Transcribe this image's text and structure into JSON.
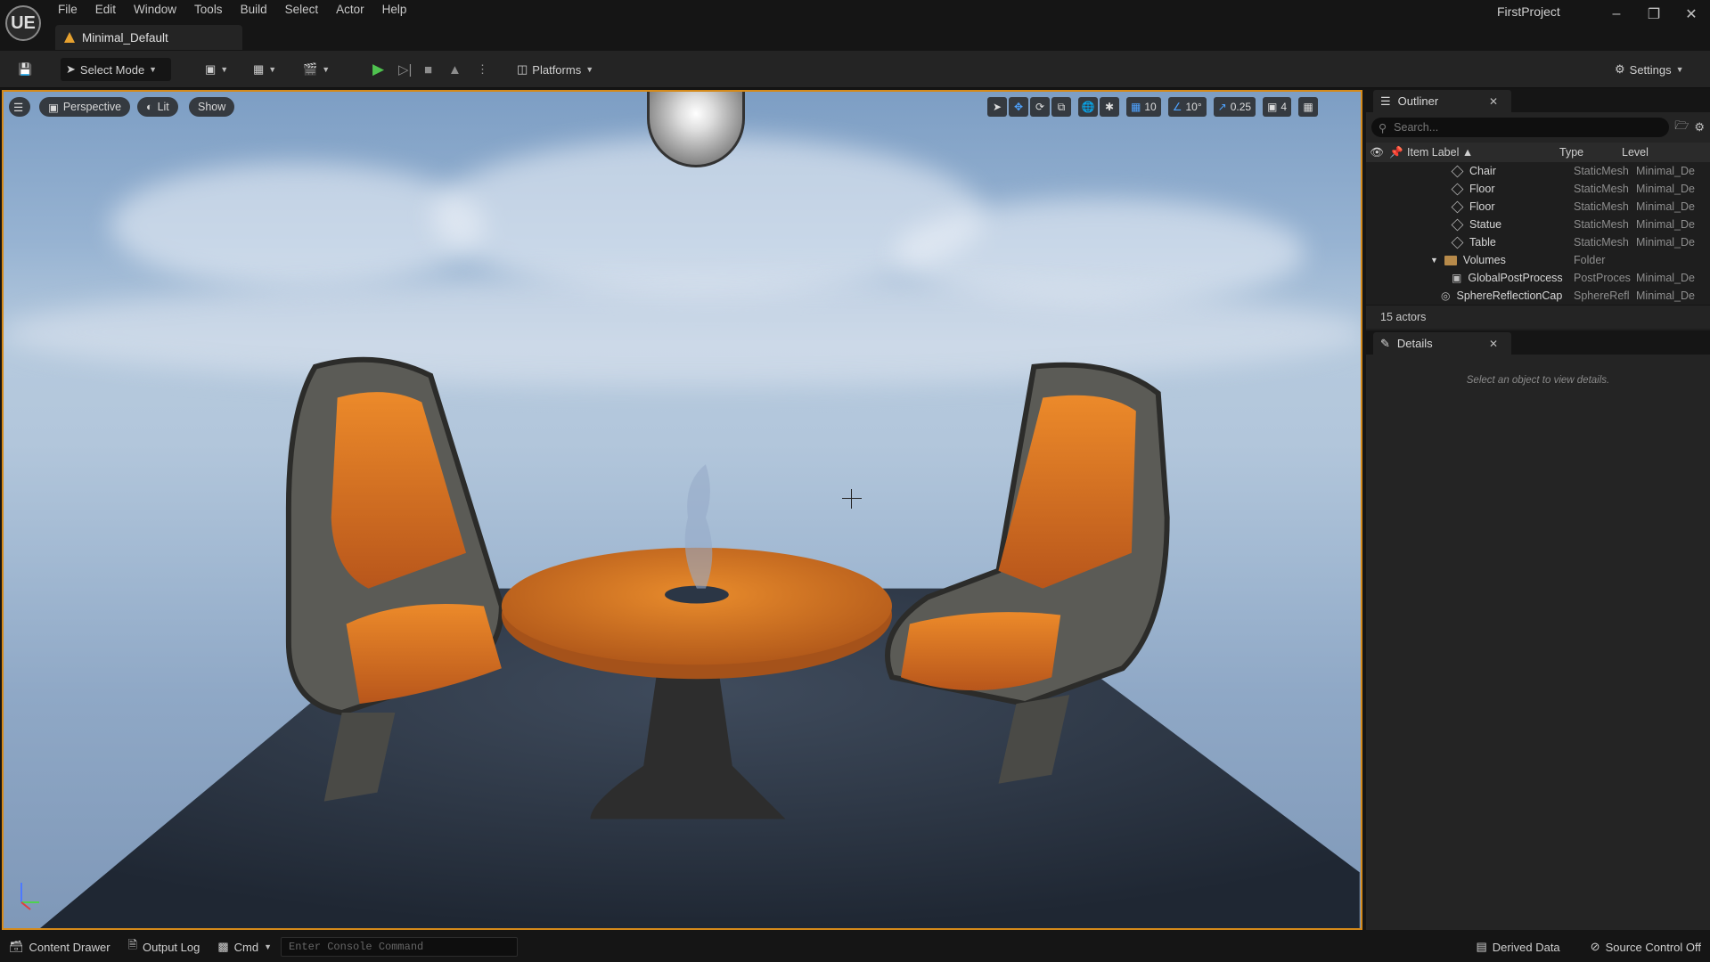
{
  "app": {
    "logo": "UE",
    "project_name": "FirstProject",
    "document_tab": "Minimal_Default"
  },
  "menu": [
    "File",
    "Edit",
    "Window",
    "Tools",
    "Build",
    "Select",
    "Actor",
    "Help"
  ],
  "toolbar": {
    "select_mode": "Select Mode",
    "platforms": "Platforms",
    "settings": "Settings"
  },
  "viewport": {
    "perspective": "Perspective",
    "lit": "Lit",
    "show": "Show",
    "grid_snap": "10",
    "rotation_snap": "10°",
    "scale_snap": "0.25",
    "camera_speed": "4"
  },
  "outliner": {
    "title": "Outliner",
    "search_placeholder": "Search...",
    "columns": {
      "label": "Item Label",
      "type": "Type",
      "level": "Level"
    },
    "rows": [
      {
        "label": "Chair",
        "type": "StaticMesh",
        "level": "Minimal_De",
        "icon": "mesh"
      },
      {
        "label": "Floor",
        "type": "StaticMesh",
        "level": "Minimal_De",
        "icon": "mesh"
      },
      {
        "label": "Floor",
        "type": "StaticMesh",
        "level": "Minimal_De",
        "icon": "mesh"
      },
      {
        "label": "Statue",
        "type": "StaticMesh",
        "level": "Minimal_De",
        "icon": "mesh"
      },
      {
        "label": "Table",
        "type": "StaticMesh",
        "level": "Minimal_De",
        "icon": "mesh"
      },
      {
        "label": "Volumes",
        "type": "Folder",
        "level": "",
        "icon": "folder"
      },
      {
        "label": "GlobalPostProcess",
        "type": "PostProces",
        "level": "Minimal_De",
        "icon": "volume"
      },
      {
        "label": "SphereReflectionCap",
        "type": "SphereRefl",
        "level": "Minimal_De",
        "icon": "sphere"
      }
    ],
    "actor_count": "15 actors"
  },
  "details": {
    "title": "Details",
    "empty_message": "Select an object to view details."
  },
  "statusbar": {
    "content_drawer": "Content Drawer",
    "output_log": "Output Log",
    "cmd": "Cmd",
    "console_placeholder": "Enter Console Command",
    "derived_data": "Derived Data",
    "source_control": "Source Control Off"
  }
}
